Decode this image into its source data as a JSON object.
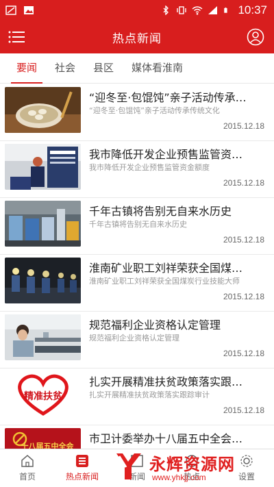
{
  "status_bar": {
    "time": "10:37",
    "icons": [
      "notification-icon",
      "image-icon",
      "bluetooth-icon",
      "vibrate-icon",
      "wifi-icon",
      "signal-icon",
      "battery-icon"
    ]
  },
  "app_bar": {
    "title": "热点新闻",
    "menu_icon": "menu-icon",
    "user_icon": "user-icon"
  },
  "tabs": [
    {
      "label": "要闻",
      "active": true
    },
    {
      "label": "社会",
      "active": false
    },
    {
      "label": "县区",
      "active": false
    },
    {
      "label": "媒体看淮南",
      "active": false
    }
  ],
  "news": [
    {
      "title": "“迎冬至·包馄饨”亲子活动传承…",
      "summary": "“迎冬至·包馄饨”亲子活动传承传统文化",
      "date": "2015.12.18"
    },
    {
      "title": "我市降低开发企业预售监管资…",
      "summary": "我市降低开发企业预售监管资金额度",
      "date": "2015.12.18"
    },
    {
      "title": "千年古镇将告别无自来水历史",
      "summary": "千年古镇将告别无自来水历史",
      "date": "2015.12.18"
    },
    {
      "title": "淮南矿业职工刘祥荣获全国煤…",
      "summary": "淮南矿业职工刘祥荣获全国煤炭行业技能大师",
      "date": "2015.12.18"
    },
    {
      "title": "规范福利企业资格认定管理",
      "summary": "规范福利企业资格认定管理",
      "date": "2015.12.18"
    },
    {
      "title": "扎实开展精准扶贫政策落实跟…",
      "summary": "扎实开展精准扶贫政策落实跟踪审计",
      "date": "2015.12.18"
    },
    {
      "title": "市卫计委举办十八届五中全会…",
      "summary": "",
      "date": ""
    }
  ],
  "thumb_text": {
    "poverty": "精准扶贫",
    "party": "十八届五中全会"
  },
  "bottom_nav": [
    {
      "label": "首页",
      "icon": "home-icon",
      "active": false
    },
    {
      "label": "热点新闻",
      "icon": "hot-news-icon",
      "active": true
    },
    {
      "label": "新闻",
      "icon": "news-icon",
      "active": false
    },
    {
      "label": "热点",
      "icon": "hot-icon",
      "active": false
    },
    {
      "label": "设置",
      "icon": "settings-icon",
      "active": false
    }
  ],
  "watermark": {
    "text": "永辉资源网",
    "url": "www.yhkjj.com"
  },
  "colors": {
    "brand_red": "#d81e1e",
    "text_dark": "#222222",
    "text_muted": "#999999"
  }
}
